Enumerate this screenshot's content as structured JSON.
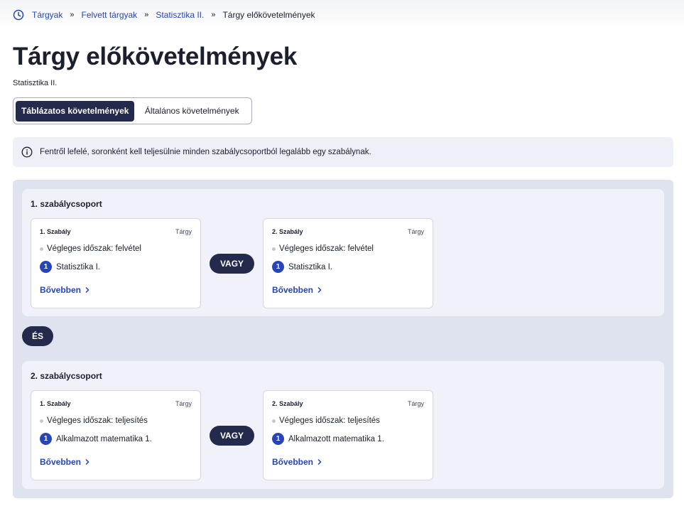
{
  "breadcrumb": {
    "items": [
      {
        "label": "Tárgyak"
      },
      {
        "label": "Felvett tárgyak"
      },
      {
        "label": "Statisztika II."
      }
    ],
    "separator": "»",
    "current": "Tárgy előkövetelmények"
  },
  "page": {
    "title": "Tárgy előkövetelmények",
    "subtitle": "Statisztika II."
  },
  "tabs": [
    {
      "label": "Táblázatos követelmények",
      "active": true
    },
    {
      "label": "Általános követelmények",
      "active": false
    }
  ],
  "info": {
    "icon": "info-icon",
    "text": "Fentről lefelé, soronként kell teljesülnie minden szabálycsoportból legalább egy szabálynak."
  },
  "connectors": {
    "or": "VAGY",
    "and": "ÉS"
  },
  "groups": [
    {
      "title": "1. szabálycsoport",
      "rules": [
        {
          "title": "1. Szabály",
          "tag": "Tárgy",
          "period": "Végleges időszak: felvétel",
          "number": "1",
          "course": "Statisztika I.",
          "more": "Bővebben"
        },
        {
          "title": "2. Szabály",
          "tag": "Tárgy",
          "period": "Végleges időszak: felvétel",
          "number": "1",
          "course": "Statisztika I.",
          "more": "Bővebben"
        }
      ]
    },
    {
      "title": "2. szabálycsoport",
      "rules": [
        {
          "title": "1. Szabály",
          "tag": "Tárgy",
          "period": "Végleges időszak: teljesítés",
          "number": "1",
          "course": "Alkalmazott matematika 1.",
          "more": "Bővebben"
        },
        {
          "title": "2. Szabály",
          "tag": "Tárgy",
          "period": "Végleges időszak: teljesítés",
          "number": "1",
          "course": "Alkalmazott matematika 1.",
          "more": "Bővebben"
        }
      ]
    }
  ],
  "colors": {
    "primary_dark": "#232a4c",
    "link_blue": "#2744b8",
    "panel_bg": "#dfe2ef",
    "group_bg": "#f1f2f9"
  }
}
